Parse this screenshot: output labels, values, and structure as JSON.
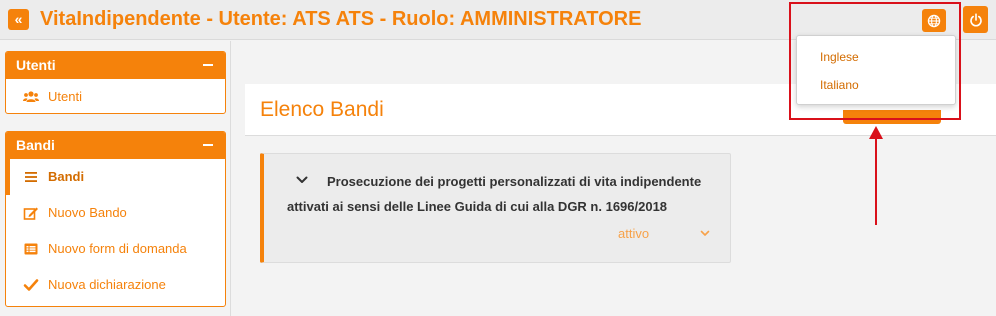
{
  "header": {
    "collapse_label": "«",
    "title": "VitaIndipendente - Utente: ATS ATS - Ruolo: AMMINISTRATORE",
    "language_icon": "globe-icon",
    "logout_icon": "power-icon"
  },
  "sidebar": {
    "panels": [
      {
        "title": "Utenti",
        "items": [
          {
            "label": "Utenti",
            "icon": "users-icon"
          }
        ]
      },
      {
        "title": "Bandi",
        "items": [
          {
            "label": "Bandi",
            "icon": "list-icon",
            "active": true
          },
          {
            "label": "Nuovo Bando",
            "icon": "edit-icon"
          },
          {
            "label": "Nuovo form di domanda",
            "icon": "form-list-icon"
          },
          {
            "label": "Nuova dichiarazione",
            "icon": "check-icon"
          }
        ]
      }
    ]
  },
  "main": {
    "title": "Elenco Bandi",
    "cards": [
      {
        "title": "Prosecuzione dei progetti personalizzati di vita indipendente attivati ai sensi delle Linee Guida di cui alla DGR n. 1696/2018",
        "status": "attivo"
      }
    ]
  },
  "language_menu": {
    "options": [
      "Inglese",
      "Italiano"
    ]
  },
  "colors": {
    "accent": "#f5820b",
    "annotation": "#d9101a"
  }
}
